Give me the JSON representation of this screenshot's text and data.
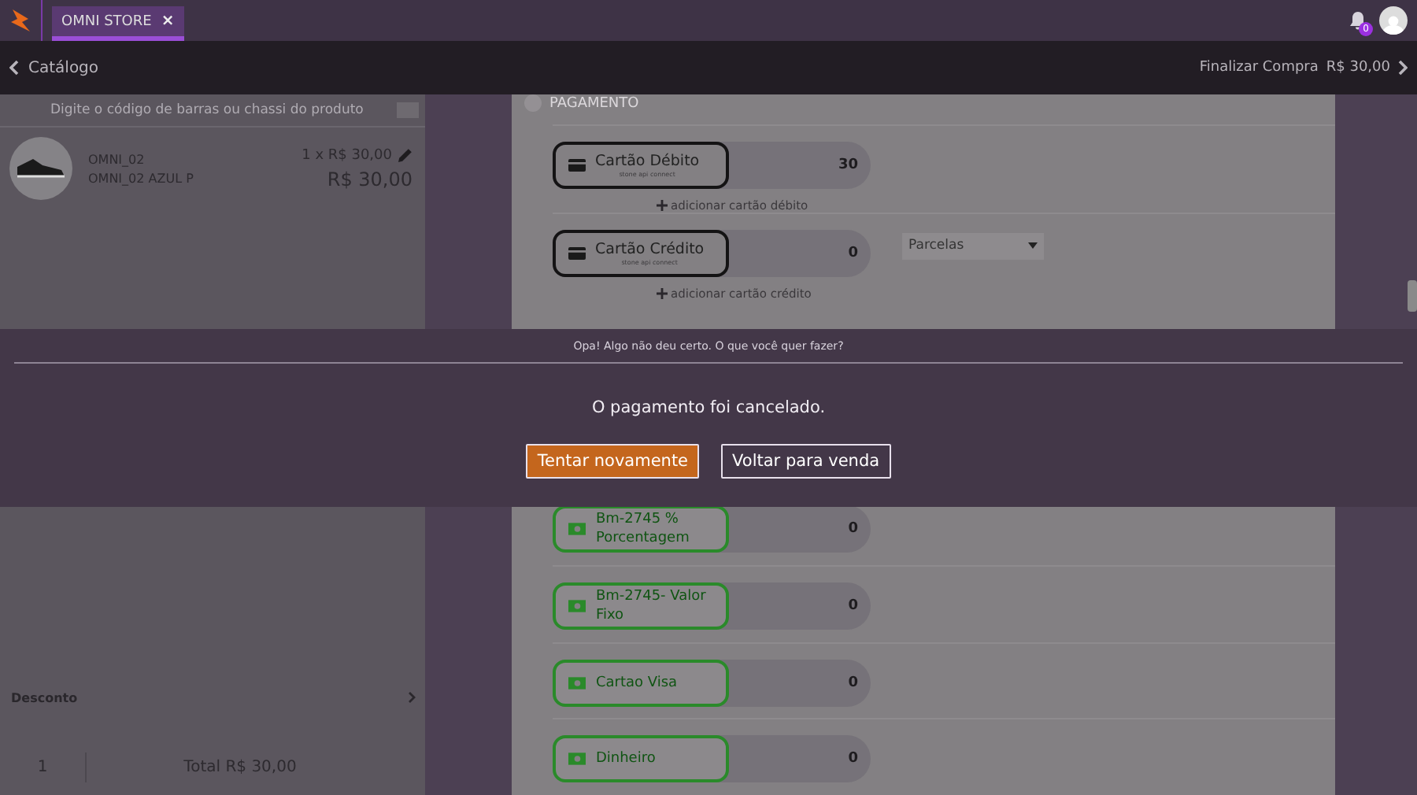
{
  "top_bar": {
    "tabs": [
      {
        "label": "OMNI STORE",
        "selected": true,
        "close_label": "×"
      }
    ],
    "notifications_badge": "0"
  },
  "nav_bar": {
    "back_label": "Catálogo",
    "checkout_label": "Finalizar Compra",
    "checkout_total": "R$ 30,00"
  },
  "cart": {
    "search": {
      "placeholder": "Digite o código de barras ou chassi do produto"
    },
    "items": [
      {
        "code": "OMNI_02",
        "name": "OMNI_02 AZUL P",
        "quantity_price": "1 x R$ 30,00",
        "total": "R$ 30,00"
      }
    ],
    "discount_label": "Desconto",
    "item_count": "1",
    "total": "Total R$ 30,00"
  },
  "payment": {
    "title": "PAGAMENTO",
    "methods": [
      {
        "kind": "card",
        "label": "Cartão Débito",
        "sublabel": "stone api connect",
        "value": "30",
        "add_label": "adicionar cartão débito"
      },
      {
        "kind": "card",
        "label": "Cartão Crédito",
        "sublabel": "stone api connect",
        "value": "0",
        "add_label": "adicionar cartão crédito",
        "installments_placeholder": "Parcelas"
      },
      {
        "kind": "hidden"
      },
      {
        "kind": "cash",
        "label": "Bm-2745 % Porcentagem",
        "value": "0"
      },
      {
        "kind": "cash",
        "label": "Bm-2745- Valor Fixo",
        "value": "0"
      },
      {
        "kind": "cash",
        "label": "Cartao Visa",
        "value": "0"
      },
      {
        "kind": "cash",
        "label": "Dinheiro",
        "value": "0"
      }
    ]
  },
  "dialog": {
    "title": "Opa! Algo não deu certo. O que você quer fazer?",
    "message": "O pagamento foi cancelado.",
    "buttons": [
      {
        "label": "Tentar novamente",
        "kind": "primary"
      },
      {
        "label": "Voltar para venda",
        "kind": "secondary"
      }
    ]
  }
}
